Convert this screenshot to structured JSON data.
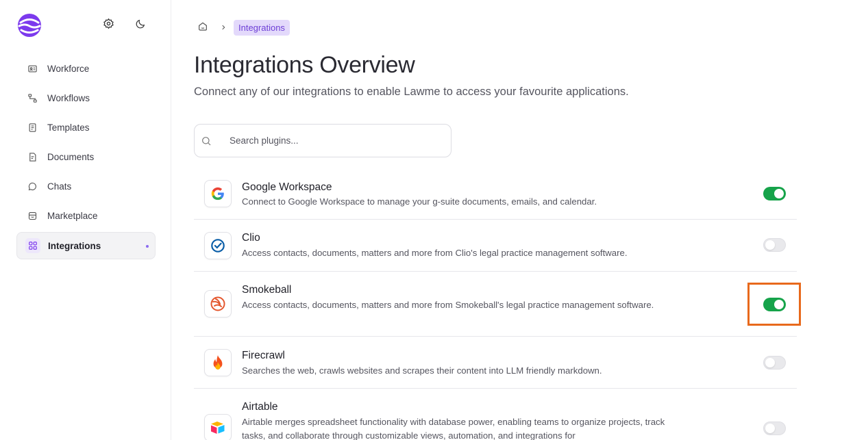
{
  "sidebar": {
    "icons": {
      "logo": "lawme-logo",
      "settings": "gear-icon",
      "theme": "moon-icon"
    },
    "items": [
      {
        "label": "Workforce",
        "icon": "id-card-icon"
      },
      {
        "label": "Workflows",
        "icon": "workflow-icon"
      },
      {
        "label": "Templates",
        "icon": "template-icon"
      },
      {
        "label": "Documents",
        "icon": "document-icon"
      },
      {
        "label": "Chats",
        "icon": "chat-icon"
      },
      {
        "label": "Marketplace",
        "icon": "marketplace-icon"
      },
      {
        "label": "Integrations",
        "icon": "grid-icon",
        "active": true
      }
    ]
  },
  "breadcrumb": {
    "home_icon": "home-icon",
    "separator_icon": "chevron-right-icon",
    "current": "Integrations"
  },
  "page": {
    "title": "Integrations Overview",
    "subtitle": "Connect any of our integrations to enable Lawme to access your favourite applications."
  },
  "search": {
    "placeholder": "Search plugins...",
    "value": ""
  },
  "integrations": [
    {
      "name": "Google Workspace",
      "description": "Connect to Google Workspace to manage your g-suite documents, emails, and calendar.",
      "enabled": true,
      "icon": "google-icon"
    },
    {
      "name": "Clio",
      "description": "Access contacts, documents, matters and more from Clio's legal practice management software.",
      "enabled": false,
      "icon": "clio-icon"
    },
    {
      "name": "Smokeball",
      "description": "Access contacts, documents, matters and more from Smokeball's legal practice management software.",
      "enabled": true,
      "icon": "smokeball-icon",
      "highlighted": true
    },
    {
      "name": "Firecrawl",
      "description": "Searches the web, crawls websites and scrapes their content into LLM friendly markdown.",
      "enabled": false,
      "icon": "fire-icon"
    },
    {
      "name": "Airtable",
      "description": "Airtable merges spreadsheet functionality with database power, enabling teams to organize projects, track tasks, and collaborate through customizable views, automation, and integrations for",
      "enabled": false,
      "icon": "airtable-icon"
    }
  ],
  "colors": {
    "accent": "#7c3aed",
    "toggle_on": "#16a34a",
    "highlight": "#e8691c"
  }
}
